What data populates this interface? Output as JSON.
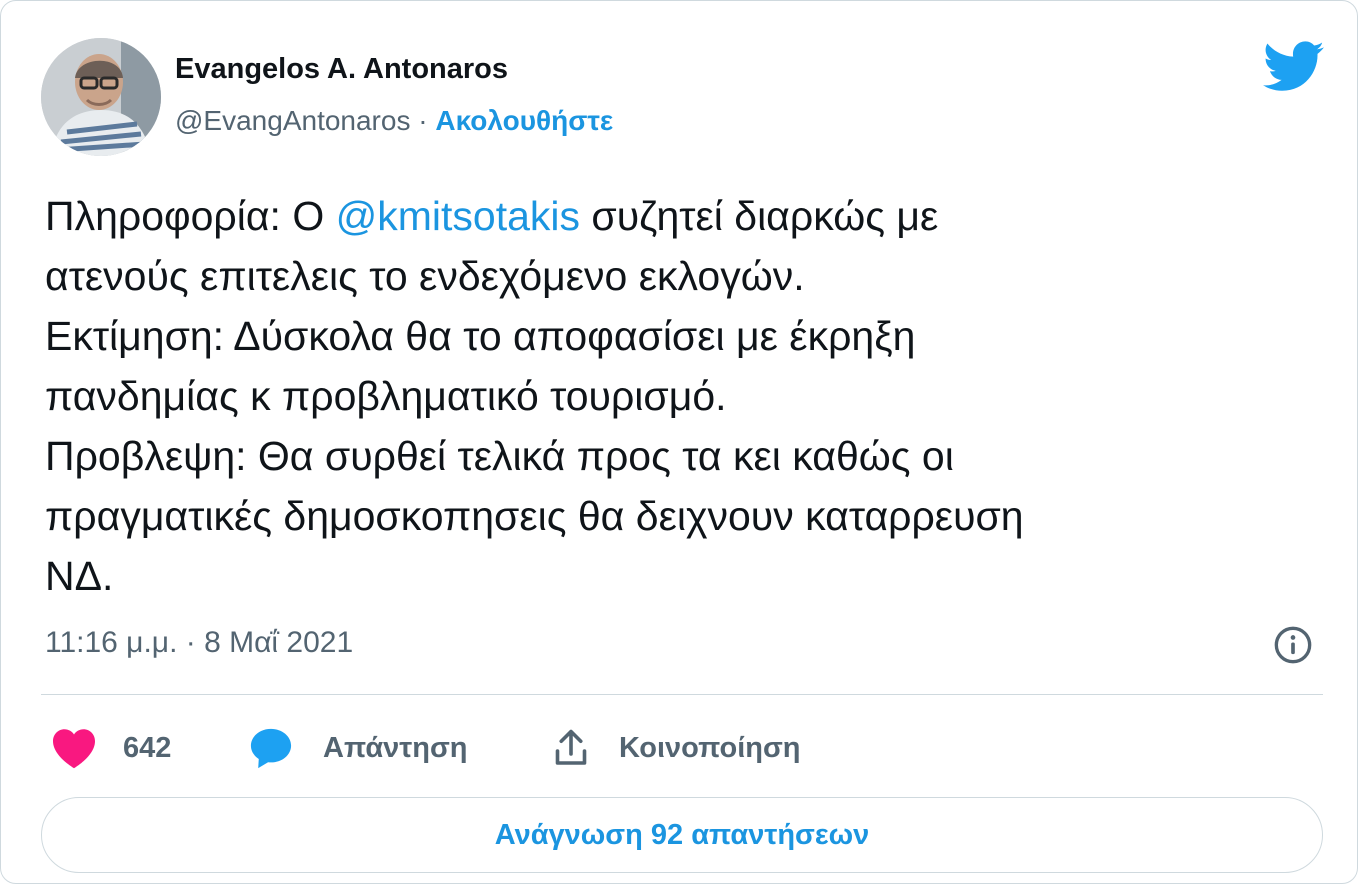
{
  "author": {
    "name": "Evangelos A. Antonaros",
    "handle": "@EvangAntonaros",
    "separator": "·",
    "follow_label": "Ακολουθήστε"
  },
  "tweet": {
    "line1_before": "Πληροφορία: Ο ",
    "mention": "@kmitsotakis",
    "line1_after": " συζητεί διαρκώς με",
    "line2": "ατενούς επιτελεις το ενδεχόμενο εκλογών.",
    "line3": "Εκτίμηση: Δύσκολα θα το αποφασίσει με έκρηξη",
    "line4": "πανδημίας κ προβληματικό τουρισμό.",
    "line5": "Προβλεψη: Θα συρθεί τελικά προς τα κει καθώς οι",
    "line6": "πραγματικές δημοσκοπησεις θα δειχνουν καταρρευση",
    "line7": "ΝΔ."
  },
  "timestamp": "11:16 μ.μ. · 8 Μαΐ 2021",
  "actions": {
    "like_count": "642",
    "reply_label": "Απάντηση",
    "share_label": "Κοινοποίηση"
  },
  "read_replies_label": "Ανάγνωση 92 απαντήσεων",
  "icons": {
    "brand": "twitter-bird-icon",
    "info": "info-icon",
    "like": "heart-icon",
    "reply": "speech-bubble-icon",
    "share": "share-upload-icon"
  },
  "colors": {
    "brand_blue": "#1da1f2",
    "link_blue": "#1b95e0",
    "heart_pink": "#f91880",
    "text_dark": "#0f1419",
    "text_gray": "#536471",
    "border": "#cfd9de"
  }
}
